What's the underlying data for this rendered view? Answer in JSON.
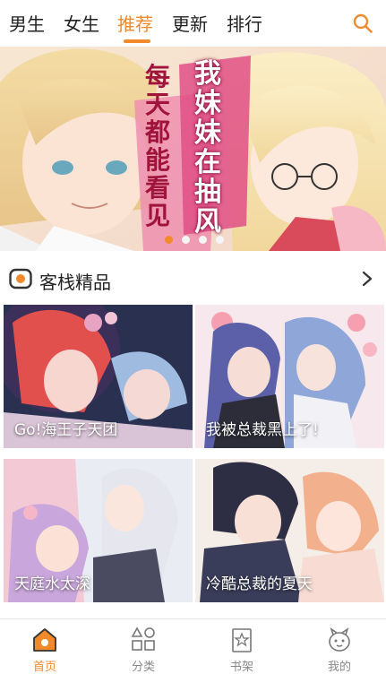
{
  "nav": {
    "tabs": [
      {
        "label": "男生"
      },
      {
        "label": "女生"
      },
      {
        "label": "推荐"
      },
      {
        "label": "更新"
      },
      {
        "label": "排行"
      }
    ],
    "active_tab": "推荐",
    "search_icon": "search-icon"
  },
  "banner": {
    "title_left": "每天都能看见",
    "title_right": "我妹妹在抽风",
    "slide_count": 4,
    "active_slide": 1
  },
  "section": {
    "title": "客栈精品",
    "icon": "inn-icon",
    "more_icon": "chevron-right-icon"
  },
  "cards": [
    {
      "title": "Go!海王子天团"
    },
    {
      "title": "我被总裁黑上了!"
    },
    {
      "title": "天庭水太深"
    },
    {
      "title": "冷酷总裁的夏天"
    }
  ],
  "bottom_nav": [
    {
      "label": "首页",
      "icon": "home-icon"
    },
    {
      "label": "分类",
      "icon": "category-icon"
    },
    {
      "label": "书架",
      "icon": "bookshelf-icon"
    },
    {
      "label": "我的",
      "icon": "profile-icon"
    }
  ],
  "colors": {
    "accent": "#f08a2b",
    "inactive": "#888888"
  }
}
